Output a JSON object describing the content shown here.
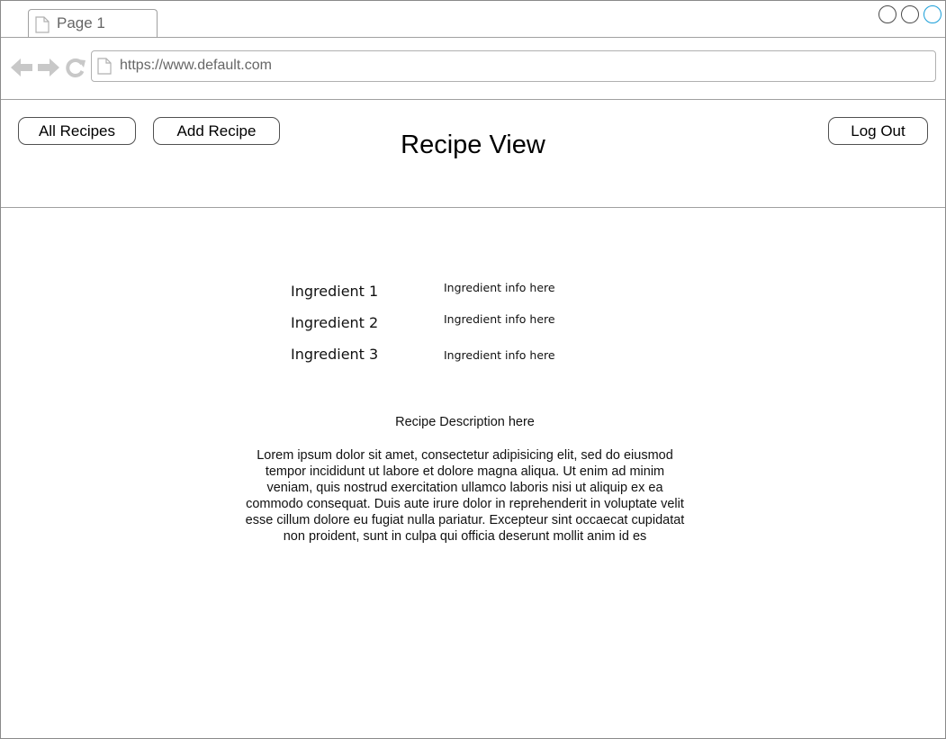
{
  "browser": {
    "tab_label": "Page 1",
    "url": "https://www.default.com",
    "icons": [
      "doc-icon",
      "back-arrow-icon",
      "forward-arrow-icon",
      "reload-icon",
      "minimize-icon",
      "restore-icon",
      "maximize-icon"
    ],
    "accent_color": "#1a9ed8"
  },
  "header": {
    "all_recipes_label": "All Recipes",
    "add_recipe_label": "Add Recipe",
    "title": "Recipe View",
    "log_out_label": "Log Out"
  },
  "ingredients": [
    {
      "name": "Ingredient 1",
      "info": "Ingredient info here"
    },
    {
      "name": "Ingredient 2",
      "info": "Ingredient info here"
    },
    {
      "name": "Ingredient 3",
      "info": "Ingredient info here"
    }
  ],
  "description": {
    "title": "Recipe Description here",
    "body": "Lorem ipsum dolor sit amet, consectetur adipisicing elit, sed do eiusmod tempor incididunt ut labore et dolore magna aliqua. Ut enim ad minim veniam, quis nostrud exercitation ullamco laboris nisi ut aliquip ex ea commodo consequat. Duis aute irure dolor in reprehenderit in voluptate velit esse cillum dolore eu fugiat nulla pariatur. Excepteur sint occaecat cupidatat non proident, sunt in culpa qui officia deserunt mollit anim id es"
  }
}
